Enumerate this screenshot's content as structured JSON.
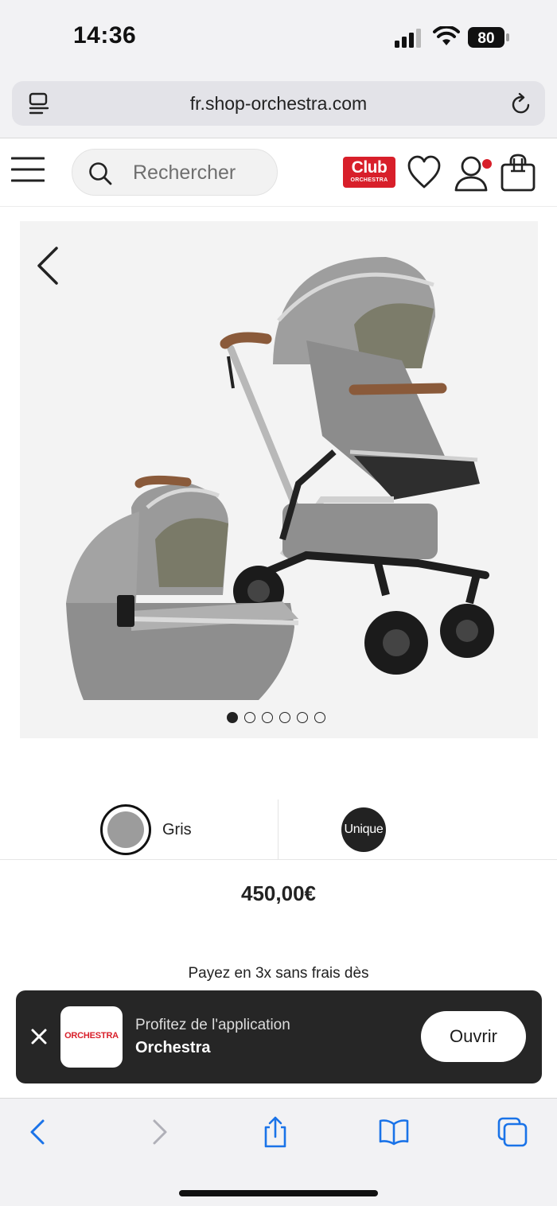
{
  "status_bar": {
    "time": "14:36",
    "battery_level": "80"
  },
  "browser": {
    "url": "fr.shop-orchestra.com"
  },
  "header": {
    "search_placeholder": "Rechercher",
    "club_logo_main": "Club",
    "club_logo_sub": "ORCHESTRA",
    "has_notification": true
  },
  "product": {
    "image_count": 6,
    "active_image": 1,
    "color_label": "Gris",
    "color_swatch": "#9c9c9c",
    "size_label": "Unique",
    "price": "450,00€",
    "installments_text": "Payez en 3x sans frais dès"
  },
  "app_banner": {
    "logo_text": "ORCHESTRA",
    "line1": "Profitez de l'application",
    "line2": "Orchestra",
    "open_label": "Ouvrir"
  },
  "colors": {
    "brand_red": "#d81f2a",
    "accent_blue": "#1a73e8",
    "banner_bg": "#262626"
  }
}
